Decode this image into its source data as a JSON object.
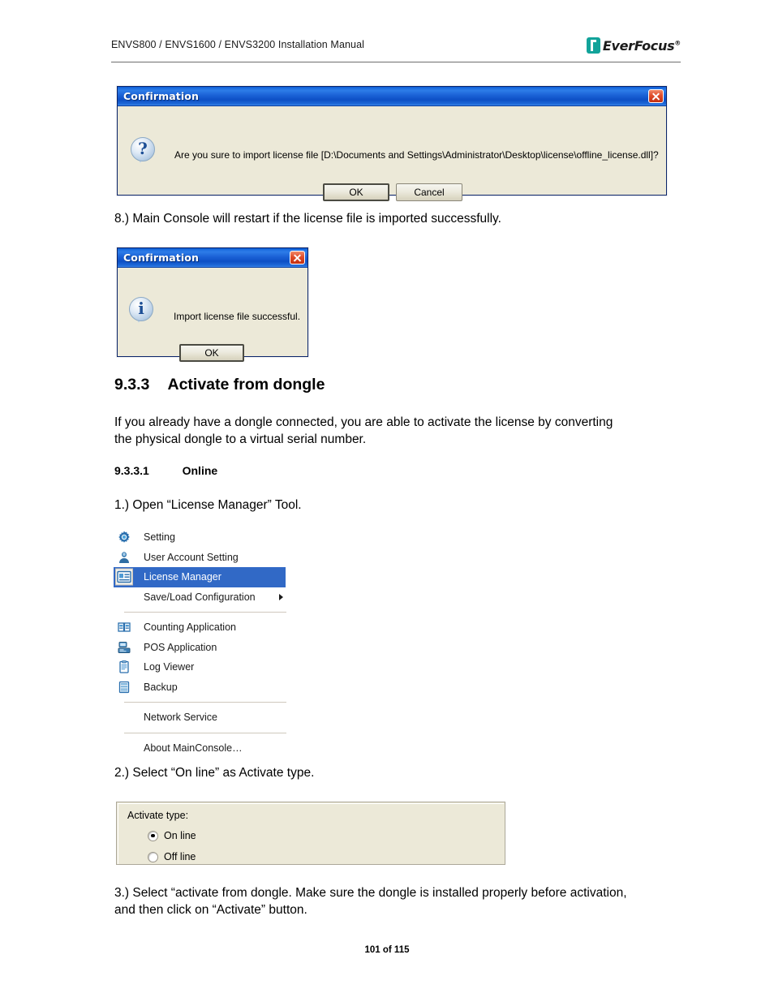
{
  "header": {
    "title": "ENVS800 / ENVS1600 / ENVS3200 Installation Manual",
    "logo_text": "EverFocus",
    "logo_registered": "®",
    "logo_color": "#12a39a"
  },
  "dialog_confirm_import": {
    "title": "Confirmation",
    "icon": "question-bubble-icon",
    "glyph": "?",
    "message": "Are you sure to import license file [D:\\Documents and Settings\\Administrator\\Desktop\\license\\offline_license.dll]?",
    "ok_label": "OK",
    "cancel_label": "Cancel",
    "close_label": "✕",
    "titlebar_color": "#1b62d6",
    "face_color": "#ece9d8"
  },
  "step_8": "8.) Main Console will restart if the license file is imported successfully.",
  "dialog_import_success": {
    "title": "Confirmation",
    "icon": "info-bubble-icon",
    "glyph": "i",
    "message": "Import license file successful.",
    "ok_label": "OK",
    "close_label": "✕"
  },
  "section": {
    "number": "9.3.3",
    "heading": "Activate from dongle",
    "paragraph": "If you already have a dongle connected, you are able to activate the license by converting the physical dongle to a virtual serial number.",
    "sub_number": "9.3.3.1",
    "sub_heading": "Online"
  },
  "step_1": "1.) Open “License Manager” Tool.",
  "context_menu": {
    "items": [
      {
        "label": "Setting",
        "icon": "gear-icon",
        "selected": false,
        "submenu": false
      },
      {
        "label": "User Account Setting",
        "icon": "user-icon",
        "selected": false,
        "submenu": false
      },
      {
        "label": "License Manager",
        "icon": "license-card-icon",
        "selected": true,
        "submenu": false
      },
      {
        "label": "Save/Load Configuration",
        "icon": "none",
        "selected": false,
        "submenu": true
      },
      {
        "label": "Counting Application",
        "icon": "counting-icon",
        "selected": false,
        "submenu": false
      },
      {
        "label": "POS Application",
        "icon": "pos-icon",
        "selected": false,
        "submenu": false
      },
      {
        "label": "Log Viewer",
        "icon": "clipboard-icon",
        "selected": false,
        "submenu": false
      },
      {
        "label": "Backup",
        "icon": "backup-icon",
        "selected": false,
        "submenu": false
      },
      {
        "label": "Network Service",
        "icon": "none",
        "selected": false,
        "submenu": false
      },
      {
        "label": "About MainConsole…",
        "icon": "none",
        "selected": false,
        "submenu": false
      }
    ],
    "highlight_color": "#3169c6"
  },
  "step_2": "2.) Select “On line” as Activate type.",
  "activate_type": {
    "label": "Activate type:",
    "options": [
      {
        "label": "On line",
        "checked": true
      },
      {
        "label": "Off line",
        "checked": false
      }
    ]
  },
  "step_3": "3.) Select “activate from dongle. Make sure the dongle is installed properly before activation, and then click on “Activate” button.",
  "footer": {
    "page_label": "101 of 115"
  }
}
